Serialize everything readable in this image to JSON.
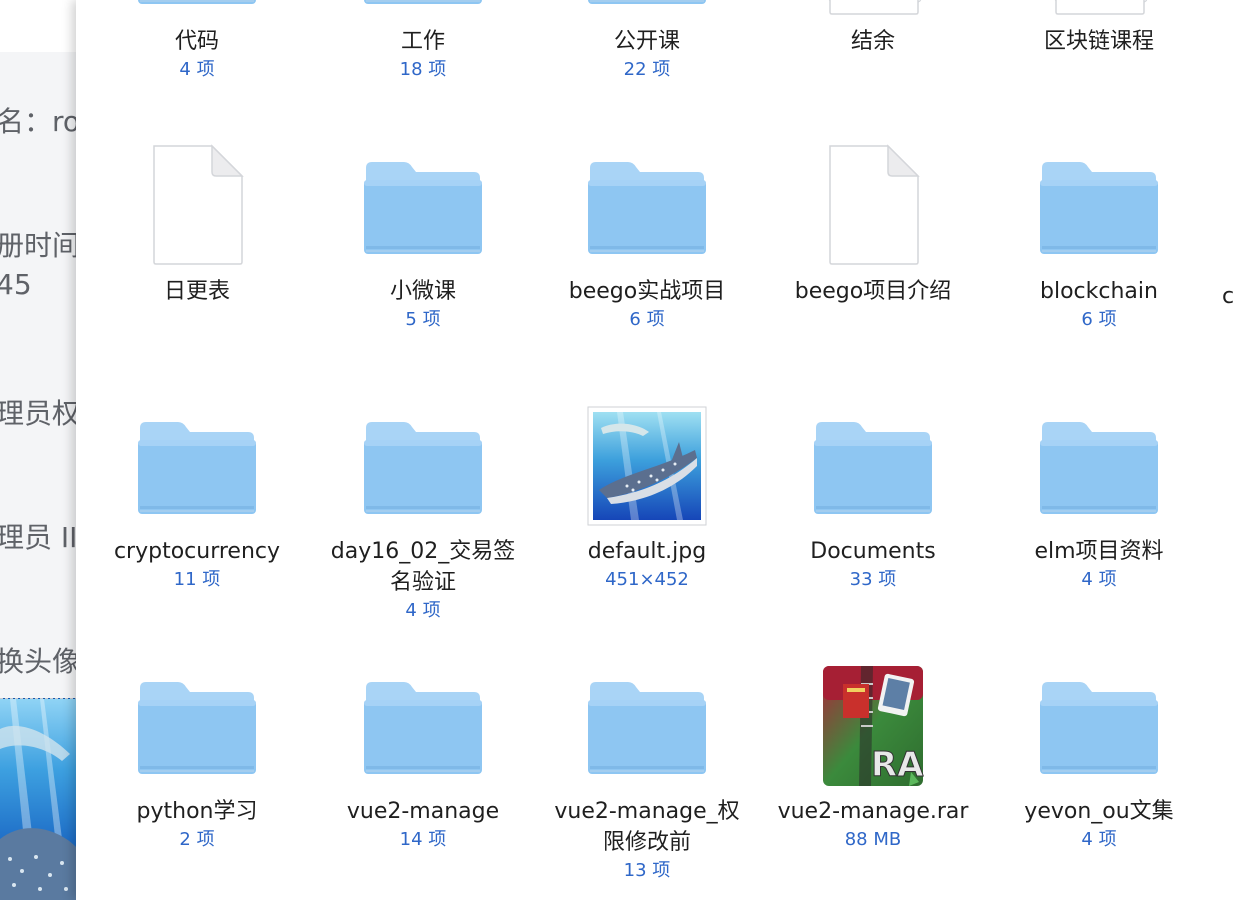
{
  "background_page": {
    "lines": [
      {
        "text": "名：ro"
      },
      {
        "text": "册时间"
      },
      {
        "text": "45"
      },
      {
        "text": "理员权"
      },
      {
        "text": "理员 II"
      },
      {
        "text": "换头像"
      }
    ]
  },
  "finder": {
    "items": [
      {
        "name": "代码",
        "meta": "4 项",
        "kind": "folder"
      },
      {
        "name": "工作",
        "meta": "18 项",
        "kind": "folder"
      },
      {
        "name": "公开课",
        "meta": "22 项",
        "kind": "folder"
      },
      {
        "name": "结余",
        "meta": "",
        "kind": "document"
      },
      {
        "name": "区块链课程",
        "meta": "",
        "kind": "document"
      },
      {
        "name": "日更表",
        "meta": "",
        "kind": "document"
      },
      {
        "name": "小微课",
        "meta": "5 项",
        "kind": "folder"
      },
      {
        "name": "beego实战项目",
        "meta": "6 项",
        "kind": "folder"
      },
      {
        "name": "beego项目介绍",
        "meta": "",
        "kind": "document"
      },
      {
        "name": "blockchain",
        "meta": "6 项",
        "kind": "folder"
      },
      {
        "name": "cryptocurrency",
        "meta": "11 项",
        "kind": "folder"
      },
      {
        "name": "day16_02_交易签名验证",
        "meta": "4 项",
        "kind": "folder"
      },
      {
        "name": "default.jpg",
        "meta": "451×452",
        "kind": "image"
      },
      {
        "name": "Documents",
        "meta": "33 项",
        "kind": "folder"
      },
      {
        "name": "elm项目资料",
        "meta": "4 项",
        "kind": "folder"
      },
      {
        "name": "python学习",
        "meta": "2 项",
        "kind": "folder"
      },
      {
        "name": "vue2-manage",
        "meta": "14 项",
        "kind": "folder"
      },
      {
        "name": "vue2-manage_权限修改前",
        "meta": "13 项",
        "kind": "folder"
      },
      {
        "name": "vue2-manage.rar",
        "meta": "88 MB",
        "kind": "archive"
      },
      {
        "name": "yevon_ou文集",
        "meta": "4 项",
        "kind": "folder"
      }
    ],
    "partial_edge_text": "c"
  },
  "colors": {
    "folder_top": "#a9d4f6",
    "folder_body": "#8cc4f1",
    "meta_blue": "#2f67c8"
  },
  "icons": {
    "folder": "folder-icon",
    "document": "document-icon",
    "image": "image-thumbnail",
    "archive": "rar-archive-icon"
  }
}
